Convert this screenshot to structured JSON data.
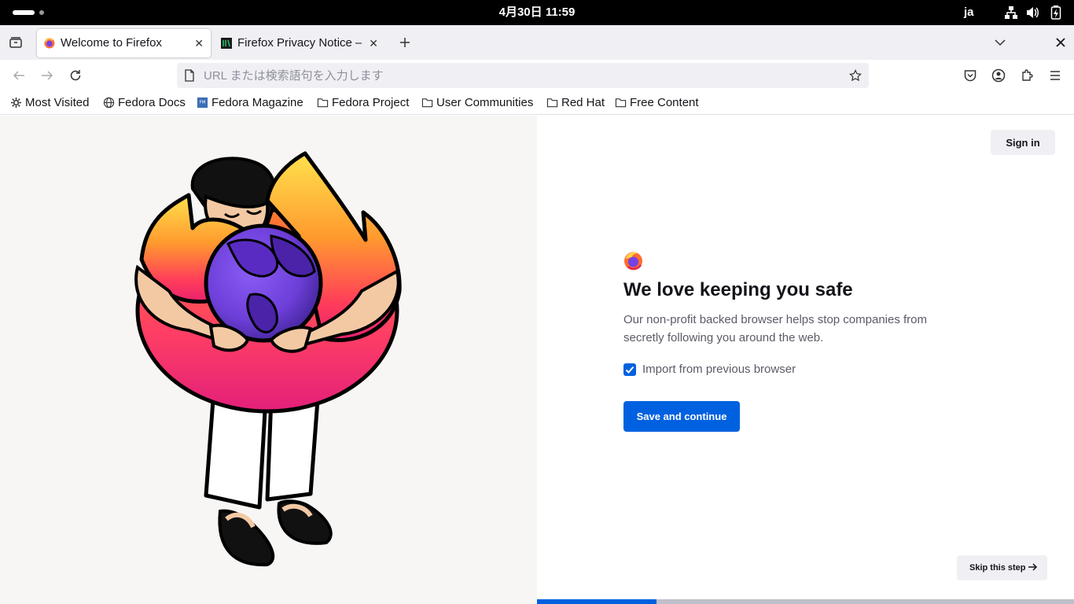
{
  "system_bar": {
    "clock": "4月30日  11:59",
    "input_language": "ja",
    "icons": [
      "network-icon",
      "volume-icon",
      "battery-icon"
    ]
  },
  "tabs": [
    {
      "title": "Welcome to Firefox",
      "active": true,
      "favicon": "firefox-icon"
    },
    {
      "title": "Firefox Privacy Notice — Mozilla",
      "active": false,
      "favicon": "mozilla-icon"
    }
  ],
  "toolbar": {
    "url_placeholder": "URL または検索語句を入力します",
    "url_value": ""
  },
  "bookmarks": [
    {
      "label": "Most Visited",
      "icon": "gear-icon"
    },
    {
      "label": "Fedora Docs",
      "icon": "globe-icon"
    },
    {
      "label": "Fedora Magazine",
      "icon": "fedora-magazine-icon"
    },
    {
      "label": "Fedora Project",
      "icon": "folder-icon"
    },
    {
      "label": "User Communities",
      "icon": "folder-icon"
    },
    {
      "label": "Red Hat",
      "icon": "folder-icon"
    },
    {
      "label": "Free Content",
      "icon": "folder-icon"
    }
  ],
  "onboarding": {
    "sign_in_label": "Sign in",
    "headline": "We love keeping you safe",
    "description": "Our non-profit backed browser helps stop companies from secretly following you around the web.",
    "import_checkbox_label": "Import from previous browser",
    "import_checked": true,
    "primary_button_label": "Save and continue",
    "skip_button_label": "Skip this step",
    "progress_fraction": 0.222
  },
  "colors": {
    "accent": "#0061e0",
    "illustration_background": "#f7f6f4",
    "tabstrip_background": "#f0f0f4"
  }
}
